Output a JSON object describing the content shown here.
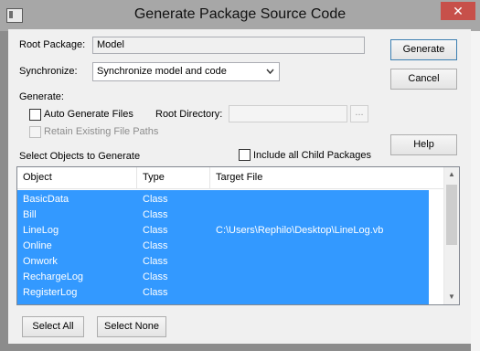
{
  "window": {
    "title": "Generate Package Source Code",
    "close_glyph": "✕"
  },
  "form": {
    "root_package_label": "Root Package:",
    "root_package_value": "Model",
    "synchronize_label": "Synchronize:",
    "synchronize_value": "Synchronize model and code",
    "generate_label": "Generate:",
    "auto_generate_label": "Auto Generate Files",
    "root_directory_label": "Root Directory:",
    "root_directory_value": "",
    "browse_label": "...",
    "retain_paths_label": "Retain Existing File Paths",
    "select_objects_label": "Select Objects to Generate",
    "include_child_label": "Include all Child Packages"
  },
  "buttons": {
    "generate": "Generate",
    "cancel": "Cancel",
    "help": "Help",
    "select_all": "Select All",
    "select_none": "Select None"
  },
  "table": {
    "headers": [
      "Object",
      "Type",
      "Target File"
    ],
    "rows": [
      {
        "object": "BasicData",
        "type": "Class",
        "target": ""
      },
      {
        "object": "Bill",
        "type": "Class",
        "target": ""
      },
      {
        "object": "LineLog",
        "type": "Class",
        "target": "C:\\Users\\Rephilo\\Desktop\\LineLog.vb"
      },
      {
        "object": "Online",
        "type": "Class",
        "target": ""
      },
      {
        "object": "Onwork",
        "type": "Class",
        "target": ""
      },
      {
        "object": "RechargeLog",
        "type": "Class",
        "target": ""
      },
      {
        "object": "RegisterLog",
        "type": "Class",
        "target": ""
      }
    ]
  },
  "icons": {
    "dropdown": "chevron-down-icon",
    "scroll_up": "scroll-up-icon",
    "scroll_down": "scroll-down-icon"
  }
}
